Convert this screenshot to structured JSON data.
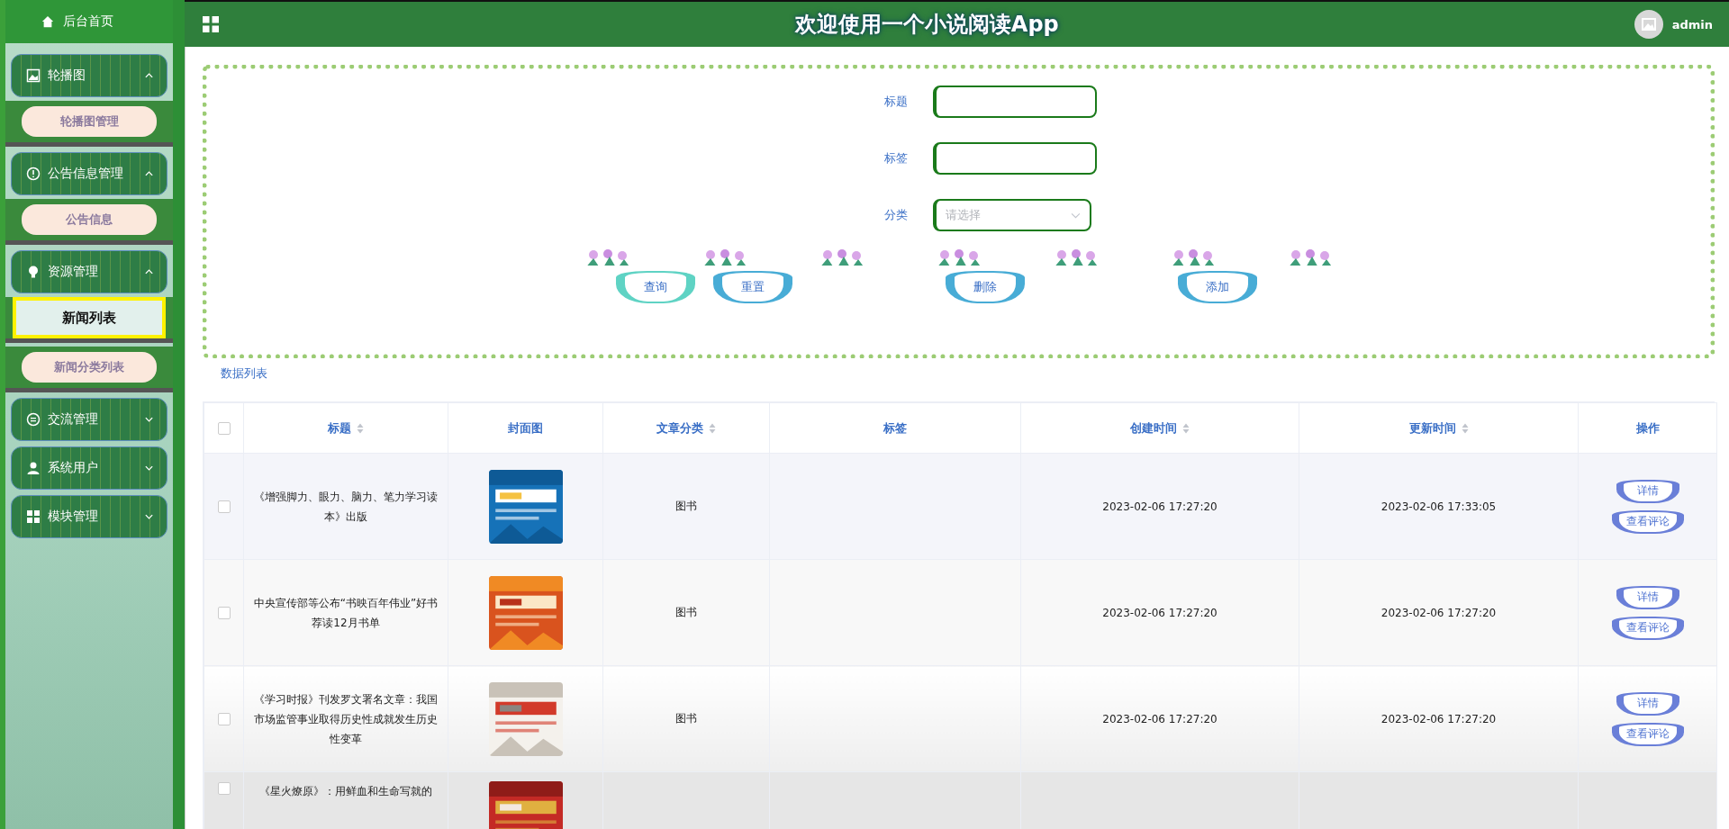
{
  "header": {
    "title": "欢迎使用一个小说阅读App",
    "user": "admin"
  },
  "sidebar": {
    "home": "后台首页",
    "groups": [
      {
        "label": "轮播图",
        "expanded": true,
        "children": [
          {
            "label": "轮播图管理",
            "selected": false
          }
        ]
      },
      {
        "label": "公告信息管理",
        "expanded": true,
        "children": [
          {
            "label": "公告信息",
            "selected": false
          }
        ]
      },
      {
        "label": "资源管理",
        "expanded": true,
        "children": [
          {
            "label": "新闻列表",
            "selected": true
          },
          {
            "label": "新闻分类列表",
            "selected": false
          }
        ]
      },
      {
        "label": "交流管理",
        "expanded": false
      },
      {
        "label": "系统用户",
        "expanded": false
      },
      {
        "label": "模块管理",
        "expanded": false
      }
    ]
  },
  "search": {
    "fields": [
      {
        "label": "标题",
        "kind": "text"
      },
      {
        "label": "标签",
        "kind": "text"
      },
      {
        "label": "分类",
        "kind": "select",
        "placeholder": "请选择"
      }
    ],
    "buttons": [
      {
        "label": "查询",
        "color": "#5fd3c4"
      },
      {
        "label": "重置",
        "color": "#48acd6"
      },
      {
        "label": "删除",
        "color": "#48acd6"
      },
      {
        "label": "添加",
        "color": "#48acd6"
      }
    ]
  },
  "list_title": "数据列表",
  "table": {
    "all_checked": false,
    "columns": [
      {
        "label": "标题",
        "sortable": true
      },
      {
        "label": "封面图",
        "sortable": false
      },
      {
        "label": "文章分类",
        "sortable": true
      },
      {
        "label": "标签",
        "sortable": false
      },
      {
        "label": "创建时间",
        "sortable": true
      },
      {
        "label": "更新时间",
        "sortable": true
      },
      {
        "label": "操作",
        "sortable": false
      }
    ],
    "rows": [
      {
        "checked": false,
        "title": "《增强脚力、眼力、脑力、笔力学习读本》出版",
        "cover": {
          "kind": "picture"
        },
        "category": "图书",
        "created": "2023-02-06 17:27:20",
        "updated": "2023-02-06 17:33:05",
        "actions": [
          "详情",
          "查看评论"
        ]
      },
      {
        "checked": false,
        "title": "中央宣传部等公布“书映百年伟业”好书荐读12月书单",
        "cover": {
          "kind": "picture"
        },
        "category": "图书",
        "created": "2023-02-06 17:27:20",
        "updated": "2023-02-06 17:27:20",
        "actions": [
          "详情",
          "查看评论"
        ]
      },
      {
        "checked": false,
        "title": "《学习时报》刊发罗文署名文章：我国市场监管事业取得历史性成就发生历史性变革",
        "cover": {
          "kind": "picture"
        },
        "category": "图书",
        "created": "2023-02-06 17:27:20",
        "updated": "2023-02-06 17:27:20",
        "actions": [
          "详情",
          "查看评论"
        ]
      },
      {
        "checked": false,
        "title": "《星火燎原》：用鲜血和生命写就的",
        "cover": {
          "kind": "picture"
        }
      }
    ]
  }
}
